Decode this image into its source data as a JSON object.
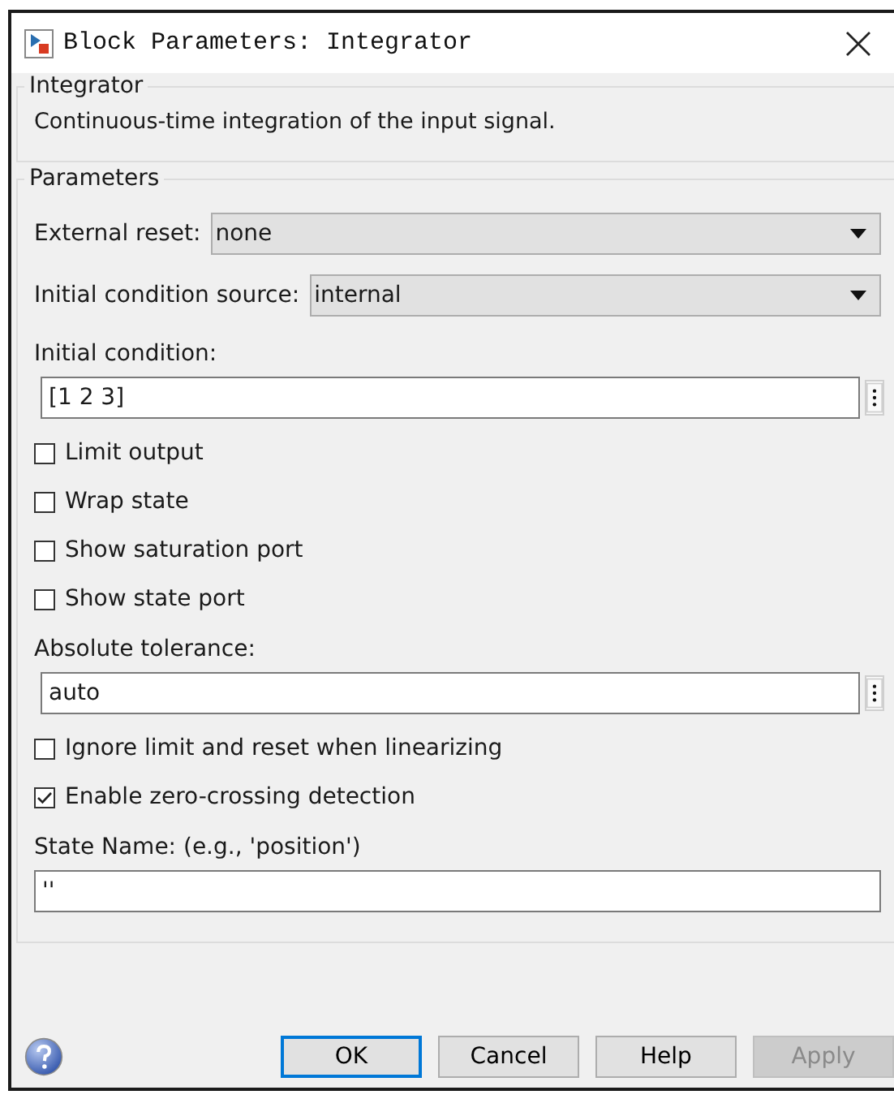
{
  "window": {
    "title": "Block Parameters: Integrator"
  },
  "description_group": {
    "title": "Integrator",
    "text": "Continuous-time integration of the input signal."
  },
  "parameters": {
    "title": "Parameters",
    "items": [
      {
        "kind": "dropdown",
        "label": "External reset:",
        "value": "none"
      },
      {
        "kind": "dropdown",
        "label": "Initial condition source:",
        "value": "internal"
      },
      {
        "kind": "field",
        "label": "Initial condition:",
        "value": "[1 2 3]",
        "menu": true
      },
      {
        "kind": "checkbox",
        "label": "Limit output",
        "checked": false
      },
      {
        "kind": "checkbox",
        "label": "Wrap state",
        "checked": false
      },
      {
        "kind": "checkbox",
        "label": "Show saturation port",
        "checked": false
      },
      {
        "kind": "checkbox",
        "label": "Show state port",
        "checked": false
      },
      {
        "kind": "field",
        "label": "Absolute tolerance:",
        "value": "auto",
        "menu": true
      },
      {
        "kind": "checkbox",
        "label": "Ignore limit and reset when linearizing",
        "checked": false
      },
      {
        "kind": "checkbox",
        "label": "Enable zero-crossing detection",
        "checked": true
      },
      {
        "kind": "field",
        "label": "State Name: (e.g., 'position')",
        "value": "''",
        "menu": false
      }
    ]
  },
  "buttons": [
    {
      "label": "OK",
      "default": true,
      "disabled": false
    },
    {
      "label": "Cancel",
      "default": false,
      "disabled": false
    },
    {
      "label": "Help",
      "default": false,
      "disabled": false
    },
    {
      "label": "Apply",
      "default": false,
      "disabled": true
    }
  ]
}
